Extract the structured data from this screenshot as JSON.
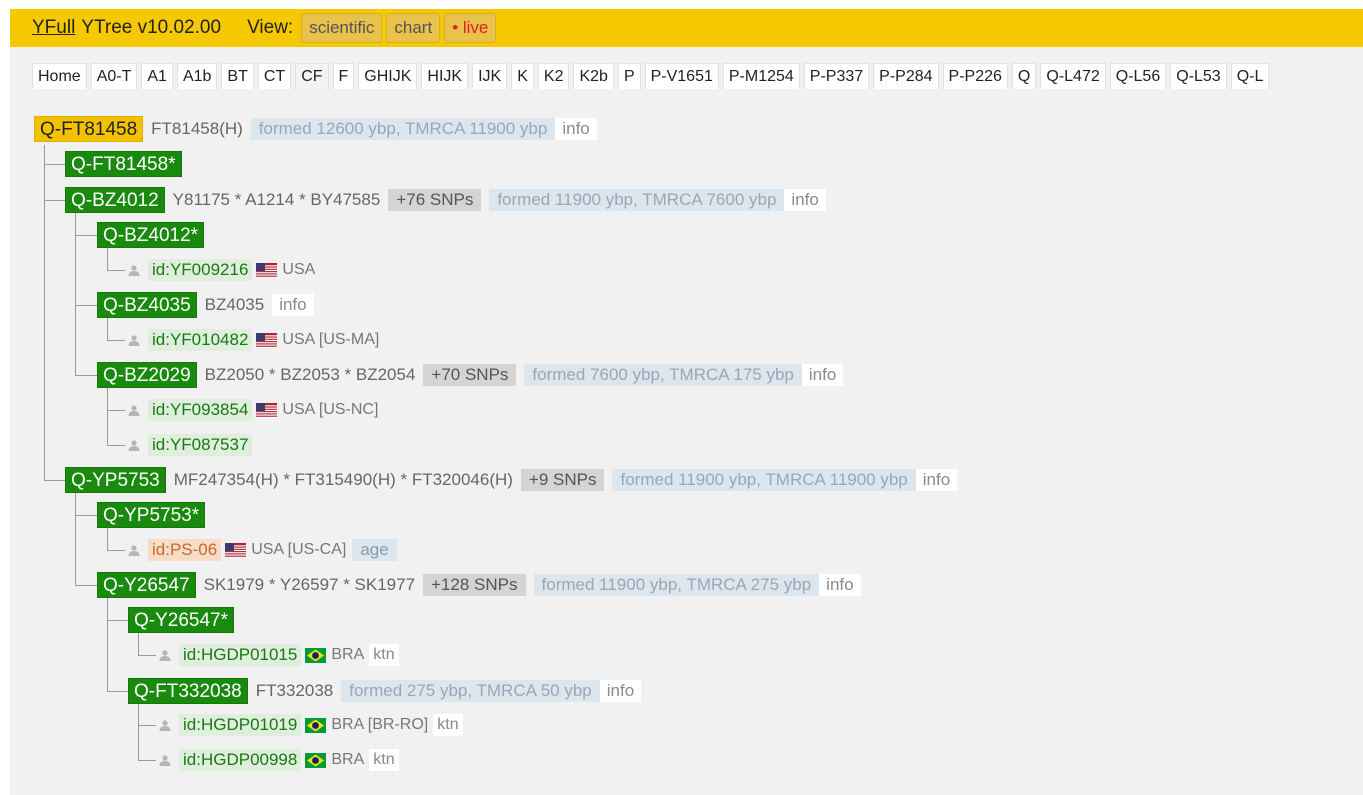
{
  "header": {
    "logo": "YFull",
    "title": "YTree v10.02.00",
    "view_label": "View:",
    "views": [
      "scientific",
      "chart",
      "• live"
    ]
  },
  "tabs": [
    "Home",
    "A0-T",
    "A1",
    "A1b",
    "BT",
    "CT",
    "CF",
    "F",
    "GHIJK",
    "HIJK",
    "IJK",
    "K",
    "K2",
    "K2b",
    "P",
    "P-V1651",
    "P-M1254",
    "P-P337",
    "P-P284",
    "P-P226",
    "Q",
    "Q-L472",
    "Q-L56",
    "Q-L53",
    "Q-L"
  ],
  "active_tab": "CF",
  "tree": {
    "root": {
      "name": "Q-FT81458",
      "snps": "FT81458(H)",
      "formed": "formed 12600 ybp, TMRCA 11900 ybp",
      "info": "info"
    },
    "n1": {
      "name": "Q-FT81458*"
    },
    "n2": {
      "name": "Q-BZ4012",
      "snps": "Y81175 * A1214 * BY47585",
      "count": "+76 SNPs",
      "formed": "formed 11900 ybp, TMRCA 7600 ybp",
      "info": "info"
    },
    "n3": {
      "name": "Q-BZ4012*"
    },
    "s1": {
      "id": "id:YF009216",
      "country": "USA"
    },
    "n4": {
      "name": "Q-BZ4035",
      "snps": "BZ4035",
      "info": "info"
    },
    "s2": {
      "id": "id:YF010482",
      "country": "USA [US-MA]"
    },
    "n5": {
      "name": "Q-BZ2029",
      "snps": "BZ2050 * BZ2053 * BZ2054",
      "count": "+70 SNPs",
      "formed": "formed 7600 ybp, TMRCA 175 ybp",
      "info": "info"
    },
    "s3": {
      "id": "id:YF093854",
      "country": "USA [US-NC]"
    },
    "s4": {
      "id": "id:YF087537"
    },
    "n6": {
      "name": "Q-YP5753",
      "snps": "MF247354(H) * FT315490(H) * FT320046(H)",
      "count": "+9 SNPs",
      "formed": "formed 11900 ybp, TMRCA 11900 ybp",
      "info": "info"
    },
    "n7": {
      "name": "Q-YP5753*"
    },
    "s5": {
      "id": "id:PS-06",
      "country": "USA [US-CA]",
      "age": "age"
    },
    "n8": {
      "name": "Q-Y26547",
      "snps": "SK1979 * Y26597 * SK1977",
      "count": "+128 SNPs",
      "formed": "formed 11900 ybp, TMRCA 275 ybp",
      "info": "info"
    },
    "n9": {
      "name": "Q-Y26547*"
    },
    "s6": {
      "id": "id:HGDP01015",
      "country": "BRA",
      "tag": "ktn"
    },
    "n10": {
      "name": "Q-FT332038",
      "snps": "FT332038",
      "formed": "formed 275 ybp, TMRCA 50 ybp",
      "info": "info"
    },
    "s7": {
      "id": "id:HGDP01019",
      "country": "BRA [BR-RO]",
      "tag": "ktn"
    },
    "s8": {
      "id": "id:HGDP00998",
      "country": "BRA",
      "tag": "ktn"
    }
  },
  "colors": {
    "header_bg": "#f5c800",
    "node_green": "#1a8a0e",
    "root_yellow": "#f2c200",
    "formed_bg": "#dce6ef",
    "sample_bg": "#dfeedd"
  }
}
